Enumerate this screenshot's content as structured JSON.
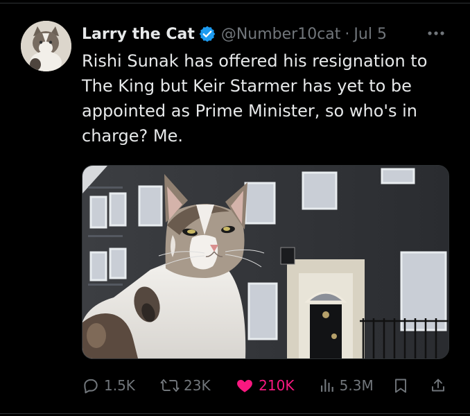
{
  "tweet": {
    "author": {
      "display_name": "Larry the Cat",
      "handle": "@Number10cat",
      "verified": true,
      "avatar": "cat-avatar"
    },
    "date": "Jul 5",
    "separator": "·",
    "more_icon": "more-icon",
    "text": "Rishi Sunak has offered his resignation to The King but Keir Starmer has yet to be appointed as Prime Minister, so who's in charge? Me.",
    "media": {
      "kind": "photo",
      "subject": "tabby-and-white-cat-in-front-of-black-brick-building"
    },
    "actions": {
      "reply": {
        "icon": "reply-icon",
        "count": "1.5K"
      },
      "repost": {
        "icon": "repost-icon",
        "count": "23K"
      },
      "like": {
        "icon": "heart-icon",
        "count": "210K",
        "active": true
      },
      "views": {
        "icon": "analytics-icon",
        "count": "5.3M"
      },
      "bookmark": {
        "icon": "bookmark-icon"
      },
      "share": {
        "icon": "share-icon"
      }
    }
  },
  "colors": {
    "background": "#000000",
    "text": "#e7e9ea",
    "secondary": "#71767b",
    "verified": "#1d9bf0",
    "like": "#f91880"
  }
}
